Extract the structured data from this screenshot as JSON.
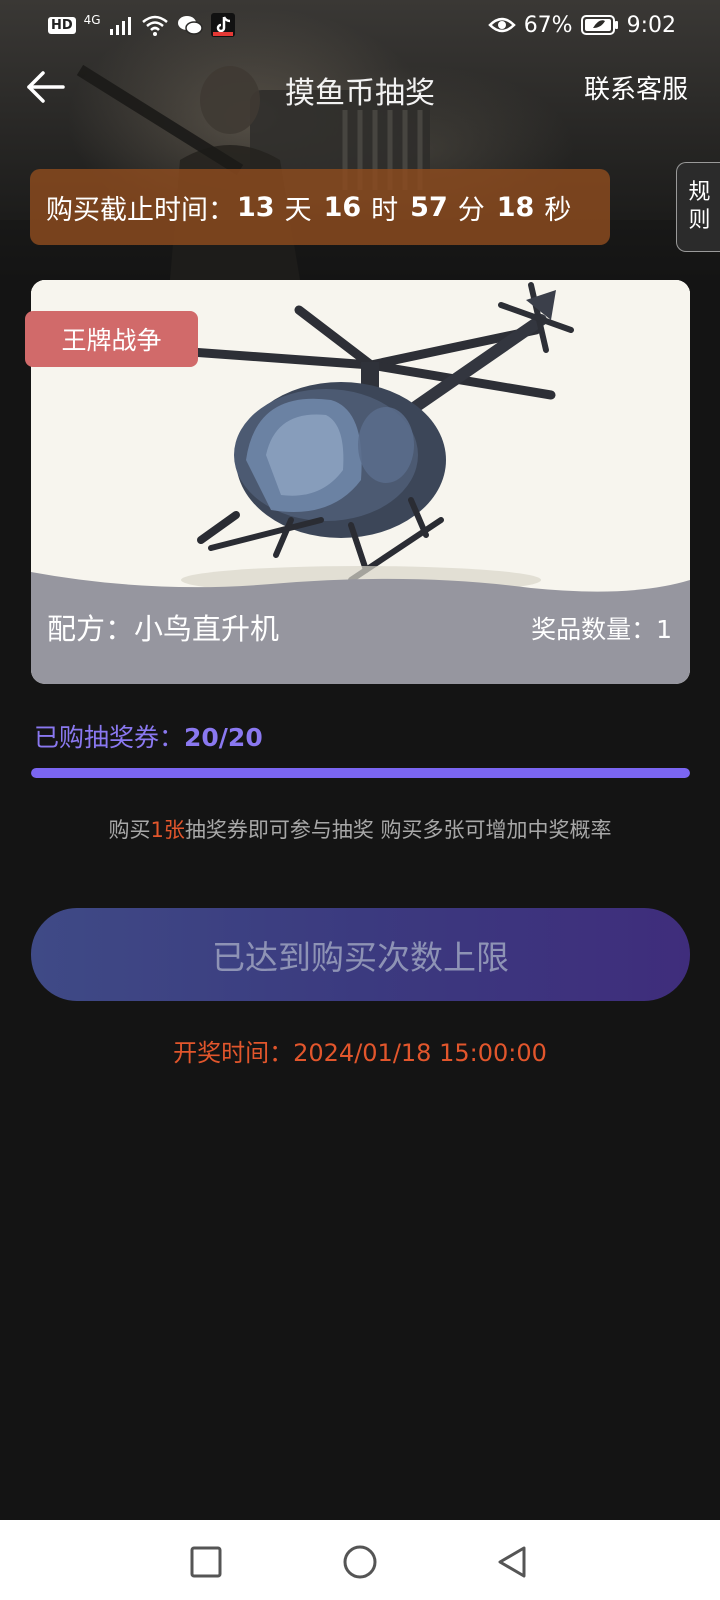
{
  "status_bar": {
    "hd": "HD",
    "network": "4G",
    "battery_percent": "67%",
    "time": "9:02"
  },
  "nav": {
    "title": "摸鱼币抽奖",
    "contact": "联系客服",
    "back_icon": "arrow-left-icon"
  },
  "deadline": {
    "label": "购买截止时间：",
    "days": "13",
    "days_unit": "天",
    "hours": "16",
    "hours_unit": "时",
    "minutes": "57",
    "minutes_unit": "分",
    "seconds": "18",
    "seconds_unit": "秒"
  },
  "rules_tab": {
    "line1": "规",
    "line2": "则"
  },
  "prize": {
    "game_tag": "王牌战争",
    "recipe": "配方：小鸟直升机",
    "quantity": "奖品数量：1",
    "image_icon": "helicopter-image"
  },
  "tickets": {
    "label": "已购抽奖券：",
    "count": "20/20",
    "progress_fraction": 1.0
  },
  "hint": {
    "part1": "购买",
    "highlight": "1张",
    "part2": "抽奖券即可参与抽奖 购买多张可增加中奖概率"
  },
  "buy_button": {
    "label": "已达到购买次数上限"
  },
  "draw_time": {
    "label": "开奖时间：2024/01/18 15:00:00"
  },
  "colors": {
    "accent_purple": "#7b66f2",
    "accent_orange": "#e2562c",
    "tag_red": "#d16a6a",
    "banner_brown": "#8e4c1e"
  },
  "android_nav": {
    "recent": "square-icon",
    "home": "circle-icon",
    "back": "triangle-back-icon"
  }
}
